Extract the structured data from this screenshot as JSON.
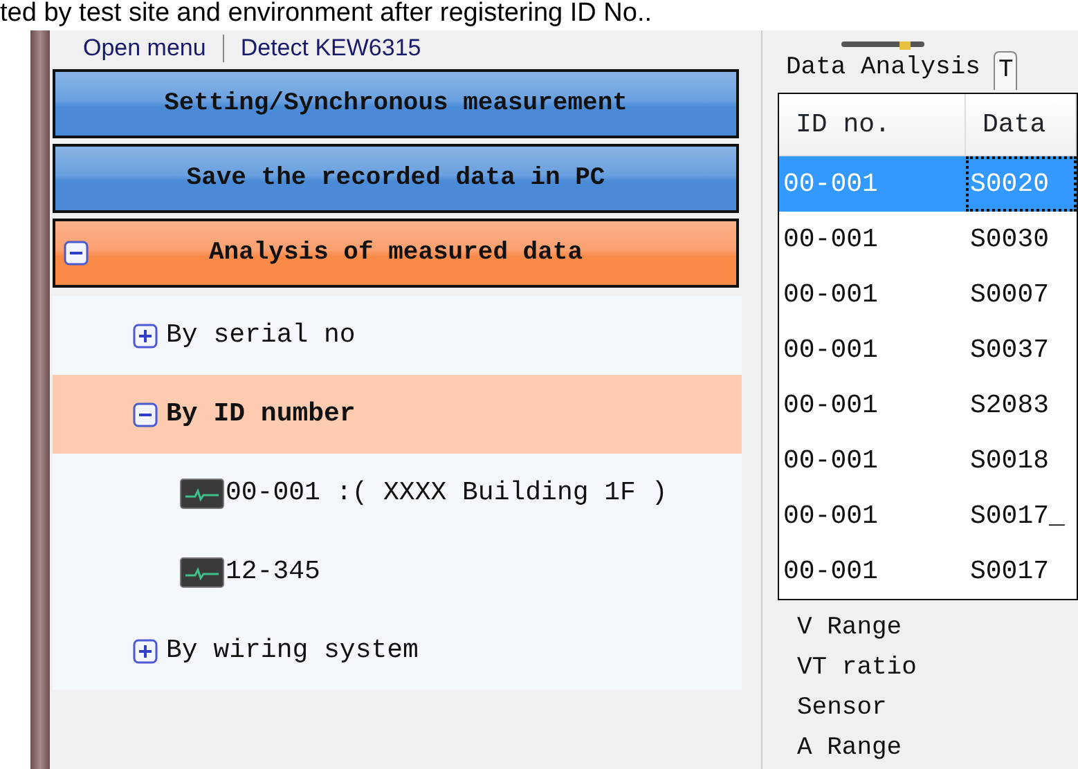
{
  "caption": "ted by test site and environment after registering ID No..",
  "menu_bar": [
    {
      "label": "Open menu"
    },
    {
      "label": "Detect KEW6315"
    }
  ],
  "nav_buttons": [
    {
      "label": "Setting/Synchronous measurement",
      "selected": false,
      "expanded": false
    },
    {
      "label": "Save the recorded data in PC",
      "selected": false,
      "expanded": false
    },
    {
      "label": "Analysis of measured data",
      "selected": true,
      "expanded": true
    }
  ],
  "tree": [
    {
      "label": "By serial no",
      "kind": "group",
      "expanded": false,
      "selected": false
    },
    {
      "label": "By ID number",
      "kind": "group",
      "expanded": true,
      "selected": true,
      "children": [
        {
          "label": "00-001 :( XXXX Building 1F )",
          "kind": "device",
          "selected": false
        },
        {
          "label": "12-345",
          "kind": "device",
          "selected": false
        }
      ]
    },
    {
      "label": "By wiring system",
      "kind": "group",
      "expanded": false,
      "selected": false
    }
  ],
  "tabs": [
    {
      "label": "Data Analysis",
      "selected": true
    },
    {
      "label": "T",
      "selected": false
    }
  ],
  "table": {
    "columns": [
      "ID no.",
      "Data"
    ],
    "rows": [
      {
        "cells": [
          "00-001",
          "S0020"
        ],
        "selected": true
      },
      {
        "cells": [
          "00-001",
          "S0030"
        ],
        "selected": false
      },
      {
        "cells": [
          "00-001",
          "S0007"
        ],
        "selected": false
      },
      {
        "cells": [
          "00-001",
          "S0037"
        ],
        "selected": false
      },
      {
        "cells": [
          "00-001",
          "S2083"
        ],
        "selected": false
      },
      {
        "cells": [
          "00-001",
          "S0018"
        ],
        "selected": false
      },
      {
        "cells": [
          "00-001",
          "S0017_"
        ],
        "selected": false
      },
      {
        "cells": [
          "00-001",
          "S0017"
        ],
        "selected": false
      }
    ]
  },
  "details": [
    "V Range",
    "VT ratio",
    "Sensor",
    "A Range"
  ]
}
